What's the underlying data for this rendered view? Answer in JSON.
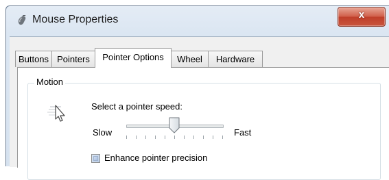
{
  "window": {
    "title": "Mouse Properties",
    "close_label": "x",
    "icon": "mouse-icon"
  },
  "tabs": [
    {
      "label": "Buttons",
      "active": false
    },
    {
      "label": "Pointers",
      "active": false
    },
    {
      "label": "Pointer Options",
      "active": true
    },
    {
      "label": "Wheel",
      "active": false
    },
    {
      "label": "Hardware",
      "active": false
    }
  ],
  "motion": {
    "group_label": "Motion",
    "prompt": "Select a pointer speed:",
    "slow_label": "Slow",
    "fast_label": "Fast",
    "speed_level": 0.5,
    "enhance_precision_label": "Enhance pointer precision",
    "enhance_precision_checked": false,
    "icon": "pointer-speed-icon"
  }
}
